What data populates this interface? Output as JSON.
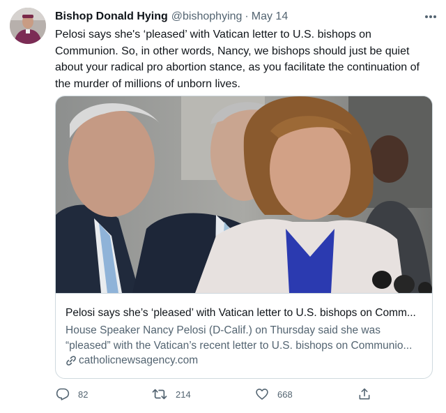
{
  "tweet": {
    "author_name": "Bishop Donald Hying",
    "handle": "@bishophying",
    "separator": "·",
    "date": "May 14",
    "text": "Pelosi says she's ‘pleased’ with Vatican letter to U.S. bishops on Communion. So, in other words, Nancy, we bishops should just be quiet about your radical pro abortion stance, as you facilitate the continuation of the murder of millions of unborn lives."
  },
  "card": {
    "title": "Pelosi says she’s ‘pleased’ with Vatican letter to U.S. bishops on Comm...",
    "description_line1": "House Speaker Nancy Pelosi (D-Calif.) on Thursday said she was",
    "description_line2": "“pleased” with the Vatican’s recent letter to U.S. bishops on Communio...",
    "domain": "catholicnewsagency.com"
  },
  "actions": {
    "replies": "82",
    "retweets": "214",
    "likes": "668"
  },
  "icons": {
    "more": "more-options-icon",
    "reply": "reply-icon",
    "retweet": "retweet-icon",
    "like": "heart-icon",
    "share": "share-icon",
    "link": "link-icon"
  },
  "colors": {
    "text_primary": "#0f1419",
    "text_secondary": "#536471",
    "border": "#cfd9de"
  }
}
